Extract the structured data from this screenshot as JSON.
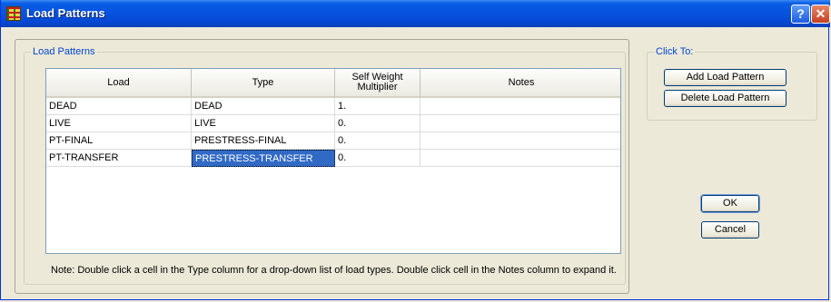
{
  "window": {
    "title": "Load Patterns",
    "help_label": "?",
    "close_label": "✕"
  },
  "load_patterns_group": {
    "legend": "Load Patterns"
  },
  "click_to_group": {
    "legend": "Click To:"
  },
  "grid": {
    "headers": [
      "Load",
      "Type",
      "Self Weight Multiplier",
      "Notes"
    ],
    "rows": [
      {
        "load": "DEAD",
        "type": "DEAD",
        "multiplier": "1.",
        "notes": ""
      },
      {
        "load": "LIVE",
        "type": "LIVE",
        "multiplier": "0.",
        "notes": ""
      },
      {
        "load": "PT-FINAL",
        "type": "PRESTRESS-FINAL",
        "multiplier": "0.",
        "notes": ""
      },
      {
        "load": "PT-TRANSFER",
        "type": "PRESTRESS-TRANSFER",
        "multiplier": "0.",
        "notes": ""
      }
    ],
    "selected": {
      "row": 3,
      "column": "type"
    }
  },
  "note": "Note:  Double click a cell in the Type column for a drop-down list of load types.  Double click cell in the Notes column to expand it.",
  "buttons": {
    "add": "Add Load Pattern",
    "delete": "Delete Load Pattern",
    "ok": "OK",
    "cancel": "Cancel"
  },
  "colors": {
    "titlebar": "#0553e0",
    "selection": "#316ac5",
    "group_legend": "#0046d5"
  }
}
